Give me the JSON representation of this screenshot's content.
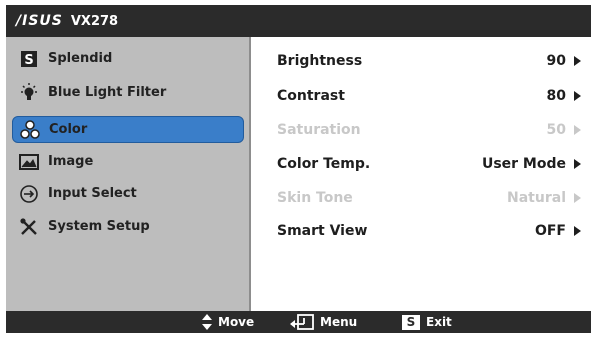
{
  "header": {
    "brand": "/ISUS",
    "model": "VX278"
  },
  "sidebar": {
    "items": [
      {
        "label": "Splendid",
        "icon": "splendid-s-icon"
      },
      {
        "label": "Blue Light Filter",
        "icon": "blue-light-filter-icon"
      },
      {
        "label": "Color",
        "icon": "color-icon",
        "selected": true
      },
      {
        "label": "Image",
        "icon": "image-icon"
      },
      {
        "label": "Input Select",
        "icon": "input-select-icon"
      },
      {
        "label": "System Setup",
        "icon": "system-setup-icon"
      }
    ]
  },
  "settings": {
    "rows": [
      {
        "name": "Brightness",
        "value": "90",
        "enabled": true
      },
      {
        "name": "Contrast",
        "value": "80",
        "enabled": true
      },
      {
        "name": "Saturation",
        "value": "50",
        "enabled": false
      },
      {
        "name": "Color Temp.",
        "value": "User Mode",
        "enabled": true
      },
      {
        "name": "Skin Tone",
        "value": "Natural",
        "enabled": false
      },
      {
        "name": "Smart View",
        "value": "OFF",
        "enabled": true
      }
    ]
  },
  "footer": {
    "move_label": "Move",
    "menu_label": "Menu",
    "exit_label": "Exit",
    "exit_key": "S"
  },
  "colors": {
    "background": "#2b2b2b",
    "sidebar": "#bdbdbd",
    "selected": "#3a7ec9",
    "disabled_text": "#c8c8c8"
  }
}
